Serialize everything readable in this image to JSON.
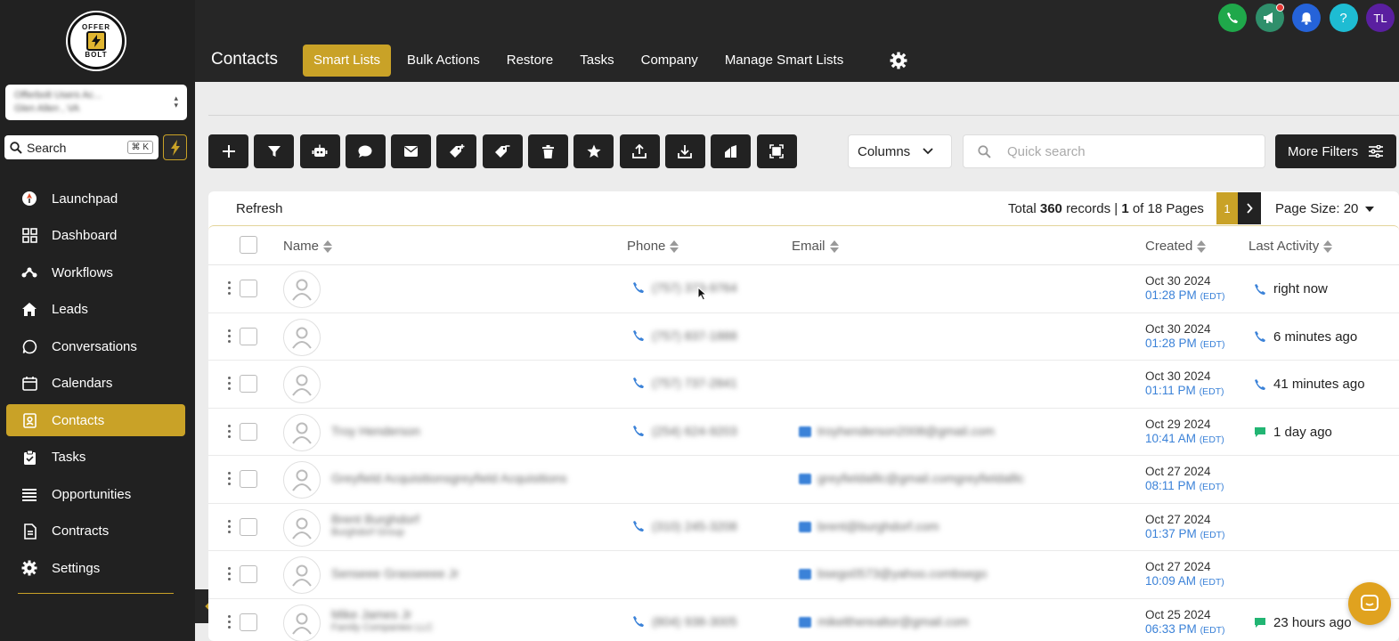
{
  "brand": {
    "logo_text_top": "OFFER",
    "logo_text_bottom": "BOLT",
    "accent": "#c9a227"
  },
  "account": {
    "line1": "Offerbolt Users Ac...",
    "line2": "Glen Allen , VA"
  },
  "search": {
    "label": "Search",
    "shortcut": "⌘ K"
  },
  "sidebar": {
    "items": [
      {
        "label": "Launchpad",
        "icon": "rocket-icon"
      },
      {
        "label": "Dashboard",
        "icon": "grid-icon"
      },
      {
        "label": "Workflows",
        "icon": "workflow-icon"
      },
      {
        "label": "Leads",
        "icon": "home-icon"
      },
      {
        "label": "Conversations",
        "icon": "chat-icon"
      },
      {
        "label": "Calendars",
        "icon": "calendar-icon"
      },
      {
        "label": "Contacts",
        "icon": "contacts-icon",
        "active": true
      },
      {
        "label": "Tasks",
        "icon": "clipboard-icon"
      },
      {
        "label": "Opportunities",
        "icon": "list-icon"
      },
      {
        "label": "Contracts",
        "icon": "document-icon"
      },
      {
        "label": "Settings",
        "icon": "gear-icon"
      }
    ]
  },
  "header": {
    "title": "Contacts",
    "tabs": [
      "Smart Lists",
      "Bulk Actions",
      "Restore",
      "Tasks",
      "Company",
      "Manage Smart Lists"
    ],
    "active_tab": "Smart Lists",
    "user_initials": "TL"
  },
  "toolbar": {
    "icons": [
      "add-icon",
      "filter-icon",
      "robot-icon",
      "message-icon",
      "mail-icon",
      "add-tag-icon",
      "remove-tag-icon",
      "trash-icon",
      "star-icon",
      "upload-icon",
      "download-icon",
      "merge-icon",
      "scan-icon"
    ],
    "columns_label": "Columns",
    "quick_search_placeholder": "Quick search",
    "more_filters_label": "More Filters"
  },
  "table_info": {
    "refresh_label": "Refresh",
    "total_prefix": "Total",
    "total_records": "360",
    "records_label": "records |",
    "current_page": "1",
    "of_pages": "of 18 Pages",
    "page_size_label": "Page Size: 20"
  },
  "columns": [
    "Name",
    "Phone",
    "Email",
    "Created",
    "Last Activity"
  ],
  "rows": [
    {
      "name": "",
      "company": "",
      "phone": "(757) 373-9764",
      "email": "",
      "date": "Oct 30 2024",
      "time": "01:28 PM",
      "tz": "(EDT)",
      "activity": "right now",
      "activity_icon": "phone"
    },
    {
      "name": "",
      "company": "",
      "phone": "(757) 837-1888",
      "email": "",
      "date": "Oct 30 2024",
      "time": "01:28 PM",
      "tz": "(EDT)",
      "activity": "6 minutes ago",
      "activity_icon": "phone"
    },
    {
      "name": "",
      "company": "",
      "phone": "(757) 737-2841",
      "email": "",
      "date": "Oct 30 2024",
      "time": "01:11 PM",
      "tz": "(EDT)",
      "activity": "41 minutes ago",
      "activity_icon": "phone"
    },
    {
      "name": "Troy Henderson",
      "company": "",
      "phone": "(254) 624-9203",
      "email": "troyhenderson2008@gmail.com",
      "date": "Oct 29 2024",
      "time": "10:41 AM",
      "tz": "(EDT)",
      "activity": "1 day ago",
      "activity_icon": "message"
    },
    {
      "name": "Greyfield Acquisitionsgreyfield Acquisitions",
      "company": "",
      "phone": "",
      "email": "greyfieldalllc@gmail.comgreyfieldalllc",
      "date": "Oct 27 2024",
      "time": "08:11 PM",
      "tz": "(EDT)",
      "activity": "",
      "activity_icon": ""
    },
    {
      "name": "Brent Burghdorf",
      "company": "Burghdorf Group",
      "phone": "(310) 245-3208",
      "email": "brent@burghdorf.com",
      "date": "Oct 27 2024",
      "time": "01:37 PM",
      "tz": "(EDT)",
      "activity": "",
      "activity_icon": ""
    },
    {
      "name": "Senseee Grasseeee Jr",
      "company": "",
      "phone": "",
      "email": "bsego0573@yahoo.combsego",
      "date": "Oct 27 2024",
      "time": "10:09 AM",
      "tz": "(EDT)",
      "activity": "",
      "activity_icon": ""
    },
    {
      "name": "Mike James Jr",
      "company": "Family Companies LLC",
      "phone": "(804) 938-3005",
      "email": "mikeltherealtor@gmail.com",
      "date": "Oct 25 2024",
      "time": "06:33 PM",
      "tz": "(EDT)",
      "activity": "23 hours ago",
      "activity_icon": "message"
    }
  ]
}
